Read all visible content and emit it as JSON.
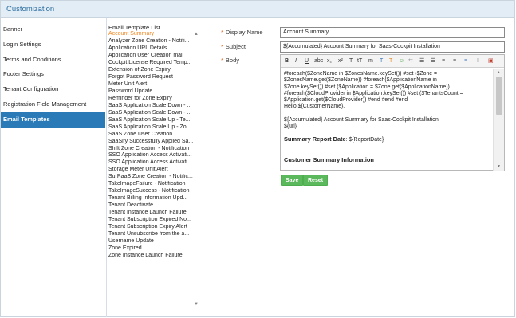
{
  "header": {
    "title": "Customization"
  },
  "nav": {
    "items": [
      {
        "label": "Banner"
      },
      {
        "label": "Login Settings"
      },
      {
        "label": "Terms and Conditions"
      },
      {
        "label": "Footer Settings"
      },
      {
        "label": "Tenant Configuration"
      },
      {
        "label": "Registration Field Management"
      },
      {
        "label": "Email Templates"
      }
    ],
    "active_label": "Email Templates"
  },
  "template_list": {
    "title": "Email Template List",
    "selected": "Account Summary",
    "items": [
      "Account Summary",
      "Analyzer Zone Creation - Notifi...",
      "Application URL Details",
      "Application User Creation mail",
      "Cockpit License Required Temp...",
      "Extension of Zone Expiry",
      "Forgot Password Request",
      "Meter Unit Alert",
      "Password Update",
      "Reminder for Zone Expiry",
      "SaaS Application Scale Down - ...",
      "SaaS Application Scale Down - ...",
      "SaaS Application Scale Up - Te...",
      "SaaS Application Scale Up - Zo...",
      "SaaS Zone User Creation",
      "SaaSify Successfully Applied Sa...",
      "Shift Zone Creation - Notification",
      "SSO Application Access Activati...",
      "SSO Application Access Activati...",
      "Storage Meter Unit Alert",
      "SurPaaS Zone Creation - Notific...",
      "TakeImageFailure - Notification",
      "TakeImageSuccess - Notification",
      "Tenant Billing Information Upd...",
      "Tenant Deactivate",
      "Tenant Instance Launch Failure",
      "Tenant Subscription Expired No...",
      "Tenant Subscription Expiry Alert",
      "Tenant Unsubscribe from the a...",
      "Username Update",
      "Zone Expired",
      "Zone Instance Launch Failure"
    ]
  },
  "form": {
    "display_name_label": "Display Name",
    "display_name_value": "Account Summary",
    "subject_label": "Subject",
    "subject_value": "${Accumulated} Account Summary for Saas-Cockpit Installation",
    "body_label": "Body",
    "required_mark": "*"
  },
  "editor": {
    "toolbar": [
      "B",
      "I",
      "U",
      "abc",
      "x₂",
      "x²",
      "T",
      "tT",
      "m",
      "T",
      "T",
      "☺",
      "⇆",
      "☰",
      "☰",
      "≡",
      "≡",
      "≡",
      "I",
      "▣"
    ],
    "body_lines": [
      "#foreach($ZoneName in $ZonesName.keySet()) #set ($Zone =",
      "$ZonesName.get($ZoneName)) #foreach($ApplicationName in",
      "$Zone.keySet()) #set ($Application = $Zone.get($ApplicationName))",
      "#foreach($CloudProvider in $Application.keySet()) #set ($TenantsCount =",
      "$Application.get($CloudProvider)) #end #end #end",
      "Hello ${CustomerName},"
    ],
    "body_line_accumulated": "${Accumulated} Account Summary for Saas-Cockpit Installation",
    "body_line_url": "${url}",
    "report_date_label": "Summary Report Date",
    "report_date_value": ": ${ReportDate}",
    "cut_line": "Customer Summary Information"
  },
  "buttons": {
    "save": "Save",
    "reset": "Reset"
  }
}
